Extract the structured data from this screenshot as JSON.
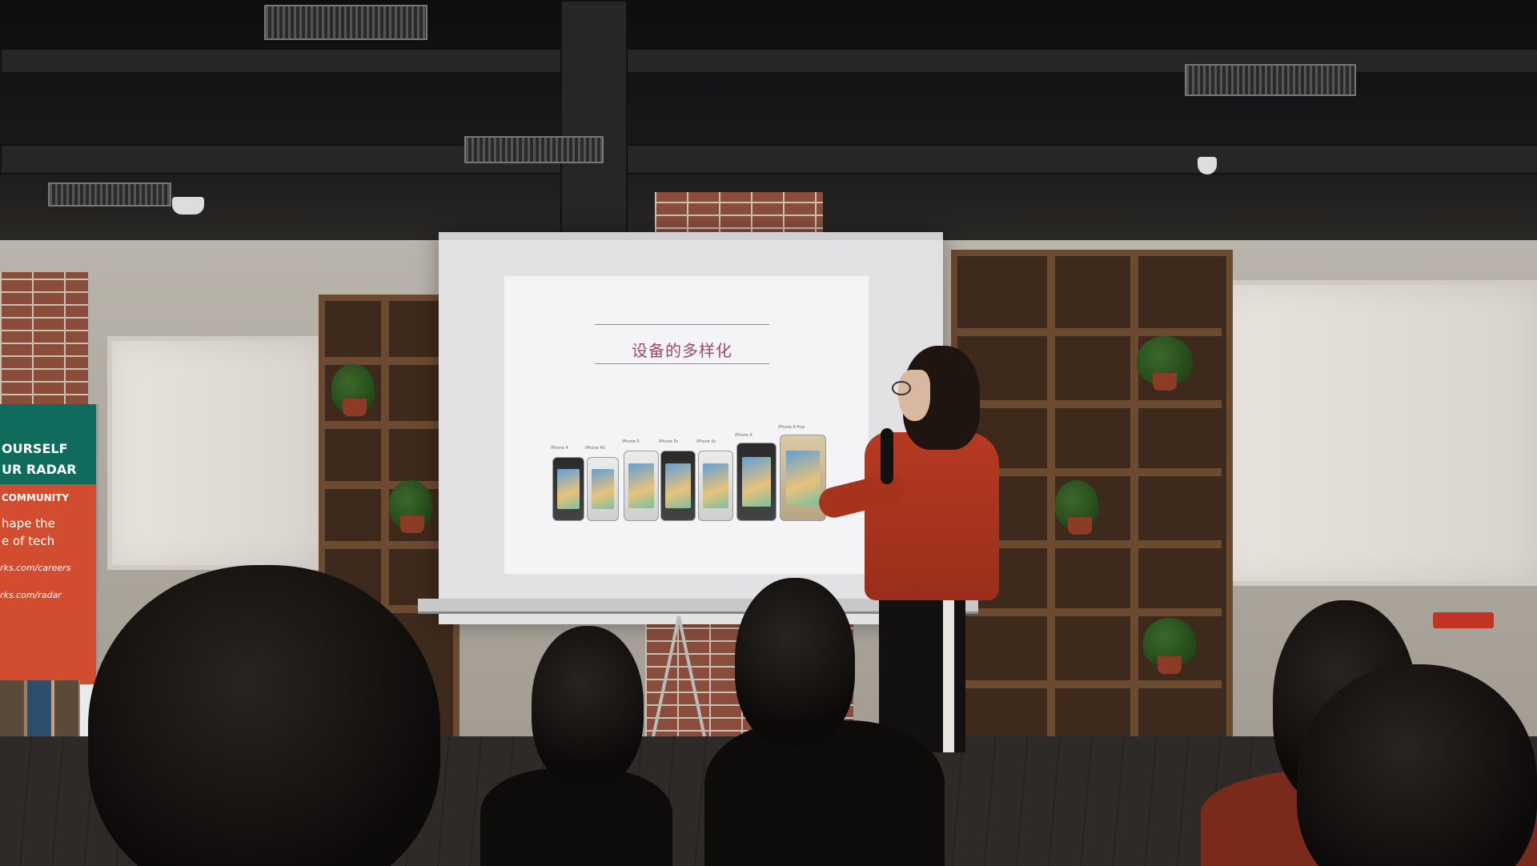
{
  "slide": {
    "title": "设备的多样化",
    "phone_labels": [
      "iPhone 4",
      "iPhone 4S",
      "iPhone 5",
      "iPhone 5s",
      "iPhone 5c",
      "iPhone 6",
      "iPhone 6 Plus"
    ]
  },
  "banner": {
    "line1": "OURSELF",
    "line2": "UR RADAR",
    "line3": "COMMUNITY",
    "line4": "hape the",
    "line5": "e of tech",
    "link1": "rks.com/careers",
    "link2": "rks.com/radar"
  },
  "colors": {
    "slide_title": "#9c4a6e",
    "presenter_top": "#b63a22",
    "banner_green": "#0f6b5c",
    "banner_red": "#d24d2f"
  }
}
